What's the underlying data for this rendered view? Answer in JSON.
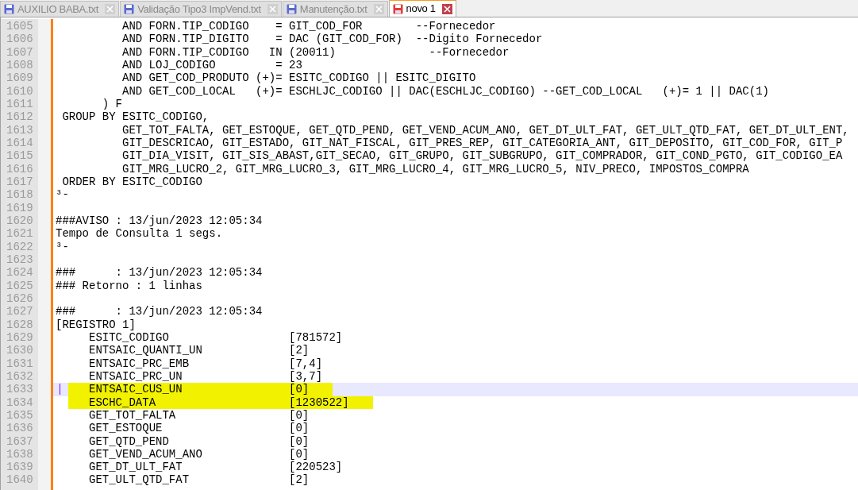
{
  "tabs": [
    {
      "label": "AUXILIO BABA.txt",
      "selected": false,
      "modified": false
    },
    {
      "label": "Validação Tipo3 ImpVend.txt",
      "selected": false,
      "modified": false
    },
    {
      "label": "Manutenção.txt",
      "selected": false,
      "modified": false
    },
    {
      "label": "novo 1",
      "selected": true,
      "modified": true
    }
  ],
  "lines": [
    {
      "number": "1605",
      "text": "          AND FORN.TIP_CODIGO    = GIT_COD_FOR        --Fornecedor",
      "current": false,
      "marked": false
    },
    {
      "number": "1606",
      "text": "          AND FORN.TIP_DIGITO    = DAC (GIT_COD_FOR)  --Digito Fornecedor",
      "current": false,
      "marked": false
    },
    {
      "number": "1607",
      "text": "          AND FORN.TIP_CODIGO   IN (20011)              --Fornecedor",
      "current": false,
      "marked": false
    },
    {
      "number": "1608",
      "text": "          AND LOJ_CODIGO         = 23",
      "current": false,
      "marked": false
    },
    {
      "number": "1609",
      "text": "          AND GET_COD_PRODUTO (+)= ESITC_CODIGO || ESITC_DIGITO",
      "current": false,
      "marked": false
    },
    {
      "number": "1610",
      "text": "          AND GET_COD_LOCAL   (+)= ESCHLJC_CODIGO || DAC(ESCHLJC_CODIGO) --GET_COD_LOCAL   (+)= 1 || DAC(1)",
      "current": false,
      "marked": false
    },
    {
      "number": "1611",
      "text": "       ) F",
      "current": false,
      "marked": false
    },
    {
      "number": "1612",
      "text": " GROUP BY ESITC_CODIGO,",
      "current": false,
      "marked": false
    },
    {
      "number": "1613",
      "text": "          GET_TOT_FALTA, GET_ESTOQUE, GET_QTD_PEND, GET_VEND_ACUM_ANO, GET_DT_ULT_FAT, GET_ULT_QTD_FAT, GET_DT_ULT_ENT,",
      "current": false,
      "marked": false
    },
    {
      "number": "1614",
      "text": "          GIT_DESCRICAO, GIT_ESTADO, GIT_NAT_FISCAL, GIT_PRES_REP, GIT_CATEGORIA_ANT, GIT_DEPOSITO, GIT_COD_FOR, GIT_P",
      "current": false,
      "marked": false
    },
    {
      "number": "1615",
      "text": "          GIT_DIA_VISIT, GIT_SIS_ABAST,GIT_SECAO, GIT_GRUPO, GIT_SUBGRUPO, GIT_COMPRADOR, GIT_COND_PGTO, GIT_CODIGO_EA",
      "current": false,
      "marked": false
    },
    {
      "number": "1616",
      "text": "          GIT_MRG_LUCRO_2, GIT_MRG_LUCRO_3, GIT_MRG_LUCRO_4, GIT_MRG_LUCRO_5, NIV_PRECO, IMPOSTOS_COMPRA",
      "current": false,
      "marked": false
    },
    {
      "number": "1617",
      "text": " ORDER BY ESITC_CODIGO",
      "current": false,
      "marked": false
    },
    {
      "number": "1618",
      "text": "³-",
      "current": false,
      "marked": false
    },
    {
      "number": "1619",
      "current": false,
      "marked": false
    },
    {
      "number": "1620",
      "text": "###AVISO : 13/jun/2023 12:05:34",
      "current": false,
      "marked": false
    },
    {
      "number": "1621",
      "text": "Tempo de Consulta 1 segs.",
      "current": false,
      "marked": false
    },
    {
      "number": "1622",
      "text": "³-",
      "current": false,
      "marked": false
    },
    {
      "number": "1623",
      "current": false,
      "marked": false
    },
    {
      "number": "1624",
      "text": "###      : 13/jun/2023 12:05:34",
      "current": false,
      "marked": false
    },
    {
      "number": "1625",
      "text": "### Retorno : 1 linhas",
      "current": false,
      "marked": false
    },
    {
      "number": "1626",
      "current": false,
      "marked": false
    },
    {
      "number": "1627",
      "text": "###      : 13/jun/2023 12:05:34",
      "current": false,
      "marked": false
    },
    {
      "number": "1628",
      "text": "[REGISTRO 1]",
      "current": false,
      "marked": false
    },
    {
      "number": "1629",
      "text": "     ESITC_CODIGO                  [781572]",
      "current": false,
      "marked": false
    },
    {
      "number": "1630",
      "text": "     ENTSAIC_QUANTI_UN             [2]",
      "current": false,
      "marked": false
    },
    {
      "number": "1631",
      "text": "     ENTSAIC_PRC_EMB               [7,4]",
      "current": false,
      "marked": false
    },
    {
      "number": "1632",
      "text": "     ENTSAIC_PRC_UN                [3,7]",
      "current": false,
      "marked": false
    },
    {
      "number": "1633",
      "text": "     ENTSAIC_CUS_UN                [0]",
      "current": true,
      "marked": true
    },
    {
      "number": "1634",
      "text": "     ESCHC_DATA                    [1230522]",
      "current": false,
      "marked": true
    },
    {
      "number": "1635",
      "text": "     GET_TOT_FALTA                 [0]",
      "current": false,
      "marked": false
    },
    {
      "number": "1636",
      "text": "     GET_ESTOQUE                   [0]",
      "current": false,
      "marked": false
    },
    {
      "number": "1637",
      "text": "     GET_QTD_PEND                  [0]",
      "current": false,
      "marked": false
    },
    {
      "number": "1638",
      "text": "     GET_VEND_ACUM_ANO             [0]",
      "current": false,
      "marked": false
    },
    {
      "number": "1639",
      "text": "     GET_DT_ULT_FAT                [220523]",
      "current": false,
      "marked": false
    },
    {
      "number": "1640",
      "text": "     GET_ULT_QTD_FAT               [2]",
      "current": false,
      "marked": false
    }
  ]
}
